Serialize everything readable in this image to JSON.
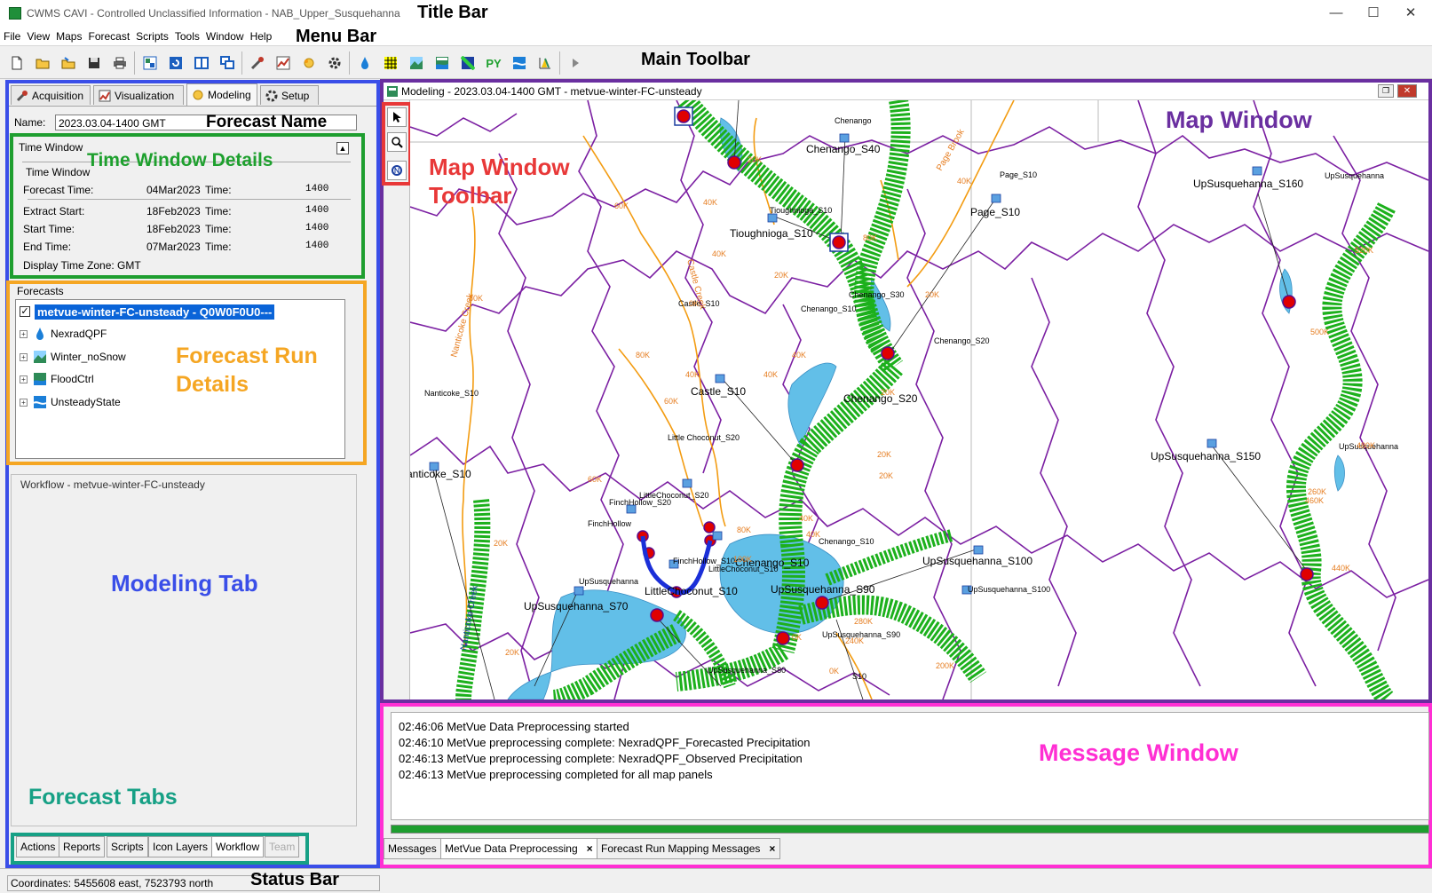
{
  "window": {
    "title": "CWMS CAVI - Controlled Unclassified Information - NAB_Upper_Susquehanna",
    "minimize_glyph": "—",
    "maximize_glyph": "☐",
    "close_glyph": "✕"
  },
  "menu": [
    "File",
    "View",
    "Maps",
    "Forecast",
    "Scripts",
    "Tools",
    "Window",
    "Help"
  ],
  "toolbar_icons": [
    "new-file-icon",
    "open-folder-icon",
    "open-watershed-icon",
    "save-icon",
    "print-icon",
    "split-view-icon",
    "refresh-icon",
    "tile-windows-icon",
    "cascade-windows-icon",
    "acquisition-tool-icon",
    "visualization-tool-icon",
    "modeling-tool-icon",
    "setup-tool-icon",
    "precip-drop-icon",
    "grid-icon",
    "landscape-icon",
    "flood-map-icon",
    "inundation-icon",
    "python-icon",
    "water-model-icon",
    "chart-icon",
    "play-icon"
  ],
  "annotations": {
    "title_bar": "Title Bar",
    "menu_bar": "Menu Bar",
    "main_toolbar": "Main Toolbar",
    "forecast_name": "Forecast Name",
    "time_window_details": "Time Window Details",
    "forecast_run_details_1": "Forecast Run",
    "forecast_run_details_2": "Details",
    "modeling_tab": "Modeling Tab",
    "forecast_tabs": "Forecast Tabs",
    "status_bar": "Status Bar",
    "map_window": "Map Window",
    "map_window_toolbar_1": "Map Window",
    "map_window_toolbar_2": "Toolbar",
    "message_window": "Message Window"
  },
  "colors": {
    "modeling_border": "#3a4ee8",
    "time_window_border": "#1e9e2f",
    "forecast_border": "#f5a623",
    "forecast_tabs_border": "#16a085",
    "map_border": "#6a2fa0",
    "map_toolbar_border": "#e83838",
    "message_border": "#ff2fd3",
    "river": "#1cb01c",
    "stream": "#f39c12",
    "basin_boundary": "#7b1fa2",
    "lake": "#62bfe8",
    "gauge": "#e00000",
    "selection": "#0a64d8"
  },
  "top_tabs": [
    {
      "label": "Acquisition",
      "icon": "acquisition-tool-icon"
    },
    {
      "label": "Visualization",
      "icon": "visualization-tool-icon"
    },
    {
      "label": "Modeling",
      "icon": "modeling-tool-icon",
      "selected": true
    },
    {
      "label": "Setup",
      "icon": "setup-tool-icon"
    }
  ],
  "forecast": {
    "name_label": "Name:",
    "name_value": "2023.03.04-1400 GMT"
  },
  "time_window": {
    "outer_title": "Time Window",
    "inner_title": "Time Window",
    "time_label": "Time:",
    "rows": [
      {
        "label": "Forecast Time:",
        "date": "04Mar2023",
        "time": "1400"
      },
      {
        "label": "Extract Start:",
        "date": "18Feb2023",
        "time": "1400"
      },
      {
        "label": "Start Time:",
        "date": "18Feb2023",
        "time": "1400"
      },
      {
        "label": "End Time:",
        "date": "07Mar2023",
        "time": "1400"
      }
    ],
    "display_tz_label": "Display Time Zone:",
    "display_tz_value": "GMT"
  },
  "forecasts": {
    "title": "Forecasts",
    "root": "metvue-winter-FC-unsteady - Q0W0F0U0---",
    "children": [
      {
        "label": "NexradQPF",
        "icon": "precip-drop-icon"
      },
      {
        "label": "Winter_noSnow",
        "icon": "landscape-icon"
      },
      {
        "label": "FloodCtrl",
        "icon": "flood-map-icon"
      },
      {
        "label": "UnsteadyState",
        "icon": "water-model-icon"
      }
    ]
  },
  "workflow": {
    "title": "Workflow - metvue-winter-FC-unsteady"
  },
  "bottom_tabs": [
    "Actions",
    "Reports",
    "Scripts",
    "Icon Layers",
    "Workflow",
    "Team"
  ],
  "map": {
    "title": "Modeling - 2023.03.04-1400 GMT - metvue-winter-FC-unsteady",
    "labels": [
      {
        "text": "Chenango",
        "small": true
      },
      {
        "text": "Chenango_S40"
      },
      {
        "text": "Page_S10",
        "small": true
      },
      {
        "text": "Page_S10"
      },
      {
        "text": "UpSusquehanna",
        "small": true
      },
      {
        "text": "UpSusquehanna_S160"
      },
      {
        "text": "Tioughnioga_S10",
        "small": true
      },
      {
        "text": "Tioughnioga_S10"
      },
      {
        "text": "Castle_S10",
        "small": true
      },
      {
        "text": "Chenango_S30",
        "small": true
      },
      {
        "text": "Chenango_S10",
        "small": true
      },
      {
        "text": "Chenango_S20",
        "small": true
      },
      {
        "text": "Castle_S10"
      },
      {
        "text": "Chenango_S20"
      },
      {
        "text": "Nanticoke_S10",
        "small": true
      },
      {
        "text": "Little Choconut_S20",
        "small": true
      },
      {
        "text": "UpSusquehanna_S150"
      },
      {
        "text": "UpSusquehanna",
        "small": true
      },
      {
        "text": "anticoke_S10"
      },
      {
        "text": "FinchHollow",
        "small": true
      },
      {
        "text": "LittleChoconut_S20",
        "small": true
      },
      {
        "text": "FinchHollow_S20",
        "small": true
      },
      {
        "text": "Chenango_S10",
        "small": true
      },
      {
        "text": "UpSusquehanna_S100"
      },
      {
        "text": "FinchHollow_S10",
        "small": true
      },
      {
        "text": "LittleChoconut_S10",
        "small": true
      },
      {
        "text": "Chenango_S10"
      },
      {
        "text": "UpSusquehanna",
        "small": true
      },
      {
        "text": "UpSusquehanna_S100",
        "small": true
      },
      {
        "text": "UpSusquehanna_S70"
      },
      {
        "text": "LittleChoconut_S10"
      },
      {
        "text": "UpSusquehanna_S90"
      },
      {
        "text": "UpSusquehanna_S80",
        "small": true
      },
      {
        "text": "UpSusquehanna_S90",
        "small": true
      },
      {
        "text": "S10",
        "small": true
      }
    ],
    "stream_labels": [
      "Castle Creek",
      "Page Brook",
      "Nanticoke Creek",
      "Nanticoke Creek"
    ],
    "mile_labels": [
      "20K",
      "40K",
      "60K",
      "80K",
      "20K",
      "40K",
      "80K",
      "20K",
      "40K",
      "0K",
      "40K",
      "80K",
      "40K",
      "60K",
      "20K",
      "40K",
      "20K",
      "40K",
      "80K",
      "100K",
      "60K",
      "0K",
      "20K",
      "40K",
      "0K",
      "200K",
      "240K",
      "280K",
      "260K",
      "520K",
      "500K",
      "480K",
      "460K",
      "440K",
      "20K",
      "20K"
    ]
  },
  "messages": {
    "lines": [
      "02:46:06 MetVue Data Preprocessing started",
      "02:46:10 MetVue preprocessing complete: NexradQPF_Forecasted Precipitation",
      "02:46:13 MetVue preprocessing complete: NexradQPF_Observed Precipitation",
      "02:46:13 MetVue preprocessing completed for all map panels"
    ],
    "progress": 100,
    "tabs": [
      {
        "label": "Messages"
      },
      {
        "label": "MetVue Data Preprocessing",
        "close": "×"
      },
      {
        "label": "Forecast Run Mapping Messages",
        "close": "×"
      }
    ]
  },
  "status": {
    "coordinates": "Coordinates: 5455608 east, 7523793 north"
  }
}
